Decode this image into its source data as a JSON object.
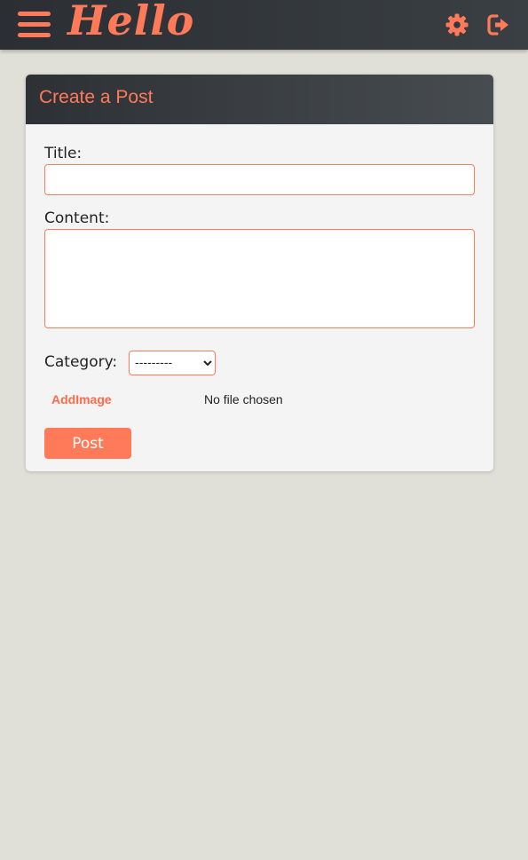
{
  "navbar": {
    "logo": "Hello",
    "menu_icon": "hamburger-menu-icon",
    "settings_icon": "gear-icon",
    "logout_icon": "logout-icon",
    "accent_color": "#ff7a59"
  },
  "form": {
    "heading": "Create a Post",
    "title_label": "Title:",
    "title_value": "",
    "content_label": "Content:",
    "content_value": "",
    "category_label": "Category:",
    "category_selected": "---------",
    "add_image_label": "AddImage",
    "file_status": "No file chosen",
    "submit_label": "Post"
  }
}
